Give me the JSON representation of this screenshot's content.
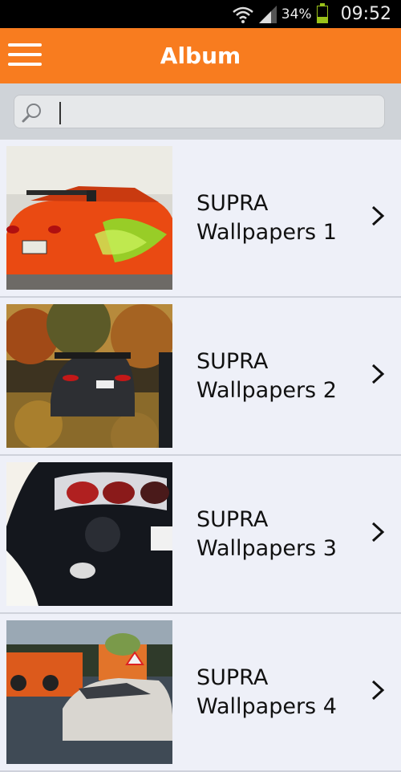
{
  "status_bar": {
    "battery_percent": "34%",
    "time": "09:52",
    "battery_level": 0.34
  },
  "app_bar": {
    "title": "Album"
  },
  "search": {
    "value": "",
    "placeholder": ""
  },
  "albums": [
    {
      "title": "SUPRA Wallpapers 1"
    },
    {
      "title": "SUPRA Wallpapers 2"
    },
    {
      "title": "SUPRA Wallpapers 3"
    },
    {
      "title": "SUPRA Wallpapers 4"
    }
  ],
  "colors": {
    "app_bar": "#f87c1f",
    "background": "#eceef6"
  },
  "icons": {
    "menu": "hamburger-menu-icon",
    "search": "magnifier-icon",
    "chevron": "chevron-right-icon",
    "wifi": "wifi-icon",
    "signal": "signal-icon",
    "battery": "battery-icon"
  }
}
